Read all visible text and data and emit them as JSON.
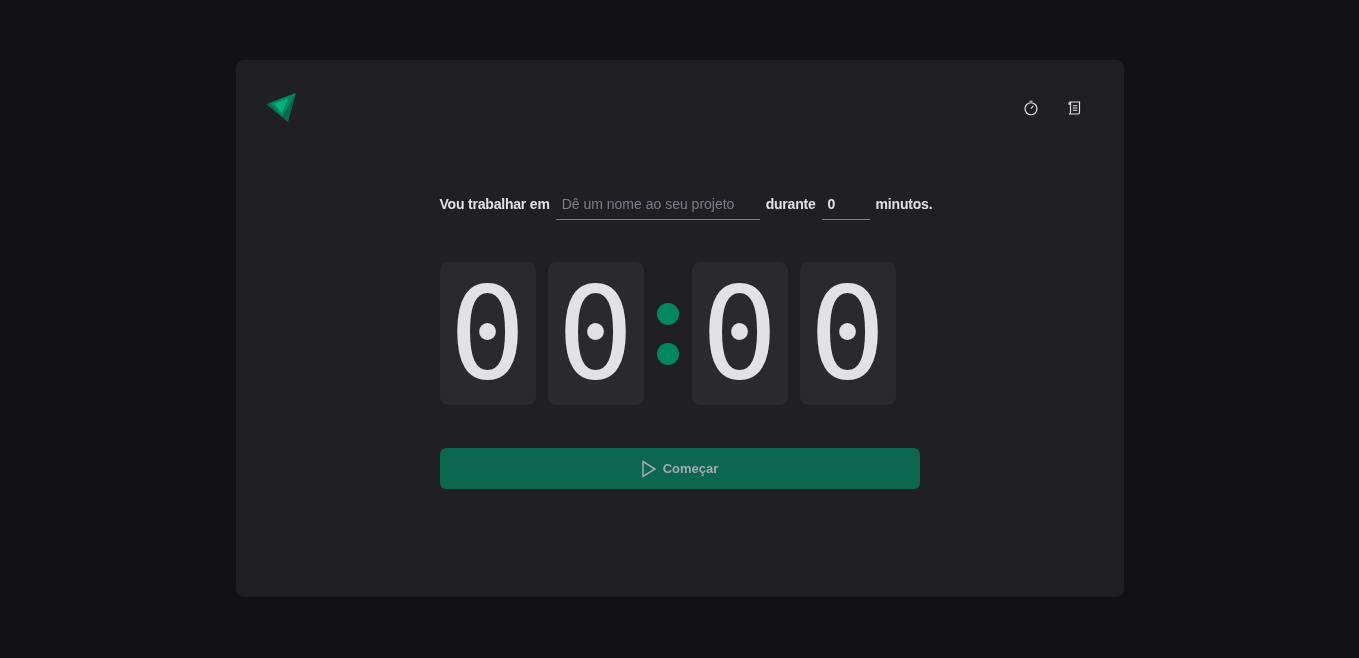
{
  "header": {
    "nav": [
      {
        "kind": "timer"
      },
      {
        "kind": "history"
      }
    ]
  },
  "form": {
    "lead": "Vou trabalhar em",
    "task": {
      "placeholder": "Dê um nome ao seu projeto"
    },
    "middle": "durante",
    "minutes": {
      "value": "0"
    },
    "tail": "minutos."
  },
  "countdown": {
    "minutes": [
      "0",
      "0"
    ],
    "seconds": [
      "0",
      "0"
    ]
  },
  "start_button": {
    "label": "Começar",
    "disabled": true
  }
}
